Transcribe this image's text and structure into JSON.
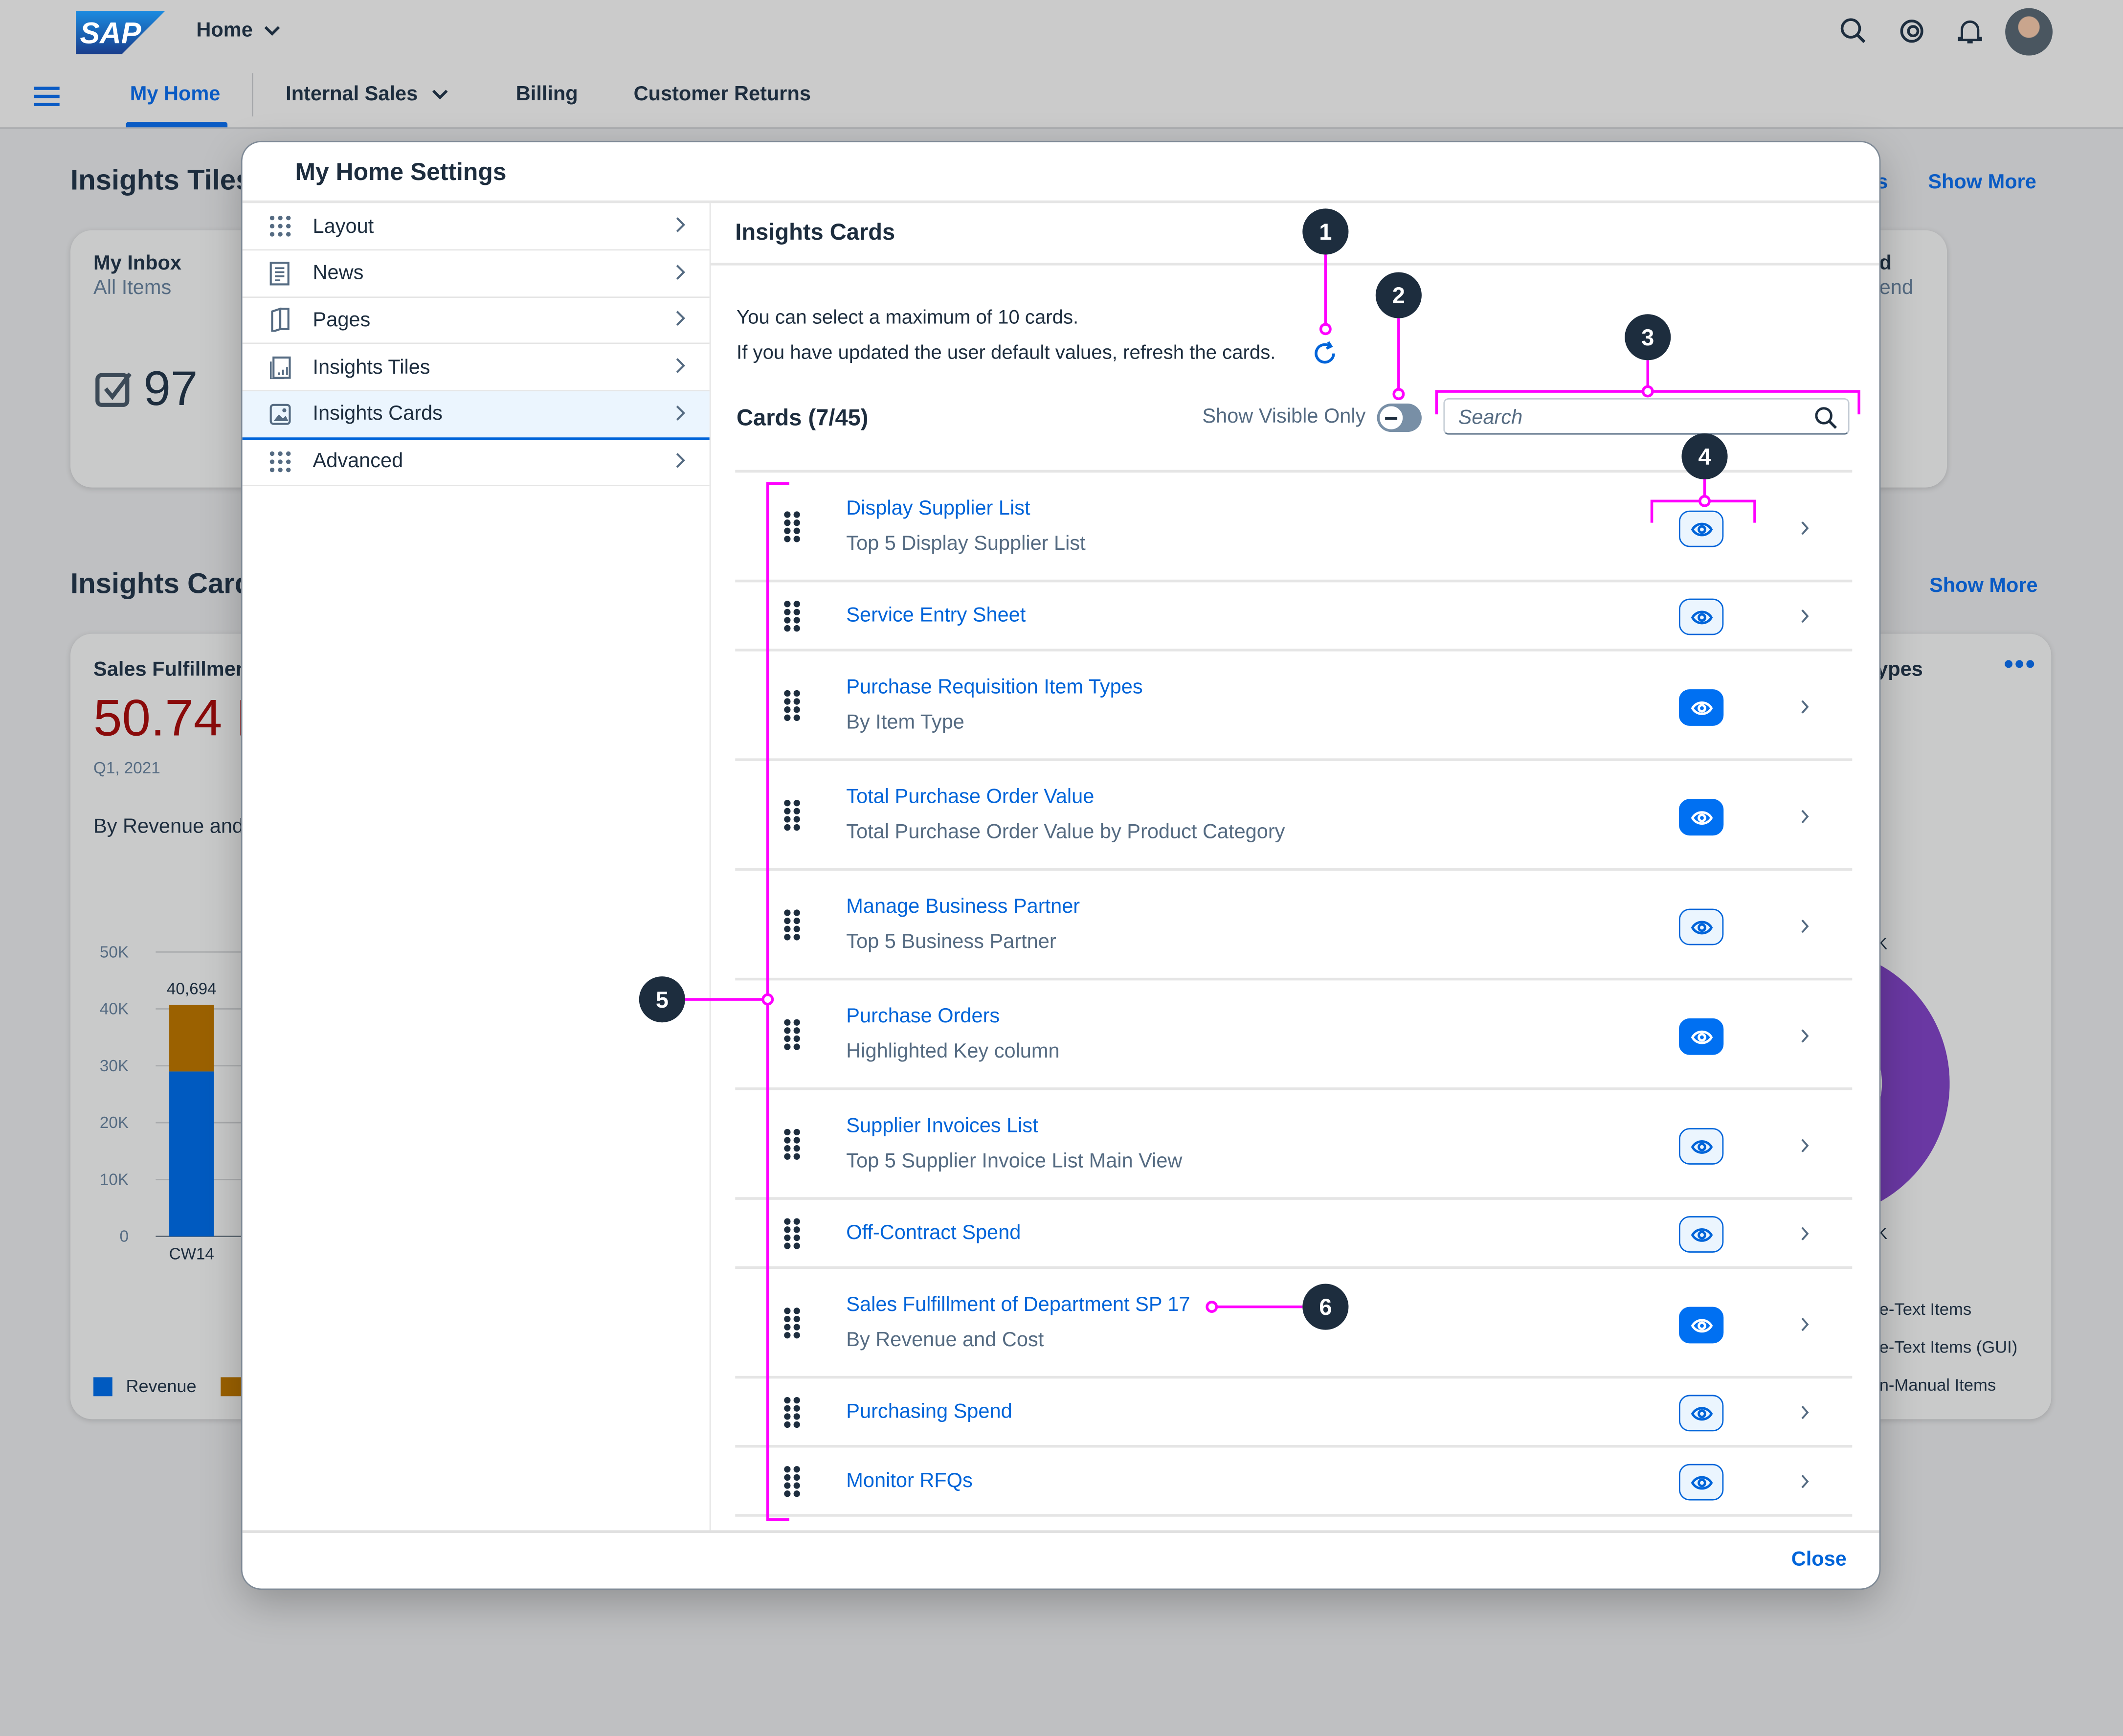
{
  "shell": {
    "logo_text": "SAP",
    "home_menu": "Home",
    "tabs": [
      {
        "label": "My Home",
        "active": true
      },
      {
        "label": "Internal Sales",
        "has_dropdown": true
      },
      {
        "label": "Billing"
      },
      {
        "label": "Customer Returns"
      }
    ],
    "icons": [
      "menu-icon",
      "search-icon",
      "joule-icon",
      "bell-icon",
      "avatar"
    ]
  },
  "background": {
    "insights_tiles_heading": "Insights Tiles",
    "show_more_1": "Show More",
    "tile_title": "My Inbox",
    "tile_subtitle": "All Items",
    "tile_value": "97",
    "tile2_title_fragment": "d",
    "tile2_subtitle_fragment": "end",
    "tiles_heading_fragment": "s",
    "insights_cards_heading": "Insights Cards",
    "show_more_2": "Show More",
    "card_title": "Sales Fulfillmen",
    "card_kpi": "50.74",
    "card_kpi_suffix": "I",
    "card_period": "Q1, 2021",
    "card_subtitle": "By Revenue and",
    "card2_title_fragment": "ypes",
    "card2_tick_fragment_1": "K",
    "card2_tick_fragment_2": "K",
    "card2_legend": [
      "e-Text Items",
      "e-Text Items (GUI)",
      "n-Manual Items"
    ],
    "legend_revenue": "Revenue"
  },
  "chart_data": {
    "type": "bar",
    "stacked": true,
    "categories": [
      "CW14"
    ],
    "series": [
      {
        "name": "Revenue",
        "values": [
          29000
        ],
        "color": "#005ac0"
      },
      {
        "values": [
          11694
        ],
        "color": "#9b6100"
      }
    ],
    "data_labels": [
      "40,694"
    ],
    "y_ticks": [
      "0",
      "10K",
      "20K",
      "30K",
      "40K",
      "50K"
    ],
    "ylim": [
      0,
      50000
    ],
    "grid": true,
    "legend": "bottom"
  },
  "dialog": {
    "title": "My Home Settings",
    "nav": [
      {
        "label": "Layout",
        "icon": "grid-icon"
      },
      {
        "label": "News",
        "icon": "news-icon"
      },
      {
        "label": "Pages",
        "icon": "pages-icon"
      },
      {
        "label": "Insights Tiles",
        "icon": "tiles-icon"
      },
      {
        "label": "Insights Cards",
        "icon": "card-image-icon",
        "selected": true
      },
      {
        "label": "Advanced",
        "icon": "grid-icon"
      }
    ],
    "panel_title": "Insights Cards",
    "info_line_1": "You can select a maximum of 10 cards.",
    "info_line_2": "If you have updated the user default values, refresh the cards.",
    "cards_count": "Cards (7/45)",
    "show_visible_only_label": "Show Visible Only",
    "show_visible_only": false,
    "search_placeholder": "Search",
    "search_value": "",
    "cards": [
      {
        "title": "Display Supplier List",
        "subtitle": "Top 5 Display Supplier List",
        "visible": false
      },
      {
        "title": "Service Entry Sheet",
        "subtitle": "",
        "visible": false
      },
      {
        "title": "Purchase Requisition Item Types",
        "subtitle": "By Item Type",
        "visible": true
      },
      {
        "title": "Total Purchase Order Value",
        "subtitle": "Total Purchase Order Value by Product Category",
        "visible": true
      },
      {
        "title": "Manage Business Partner",
        "subtitle": "Top 5 Business Partner",
        "visible": false
      },
      {
        "title": "Purchase Orders",
        "subtitle": "Highlighted Key column",
        "visible": true
      },
      {
        "title": "Supplier Invoices List",
        "subtitle": "Top 5 Supplier Invoice List Main View",
        "visible": false
      },
      {
        "title": "Off-Contract Spend",
        "subtitle": "",
        "visible": false
      },
      {
        "title": "Sales Fulfillment of Department SP 17",
        "subtitle": "By Revenue and Cost",
        "visible": true
      },
      {
        "title": "Purchasing Spend",
        "subtitle": "",
        "visible": false
      },
      {
        "title": "Monitor RFQs",
        "subtitle": "",
        "visible": false
      }
    ],
    "close_label": "Close"
  },
  "annotations": {
    "labels": [
      "1",
      "2",
      "3",
      "4",
      "5",
      "6"
    ],
    "color": "#ff00ff",
    "marker_color": "#1d2d3e"
  },
  "colors": {
    "accent": "#0064d9",
    "eye_on": "#0070f2",
    "kpi": "#8a0a0a",
    "donut": "#6a38a3"
  }
}
